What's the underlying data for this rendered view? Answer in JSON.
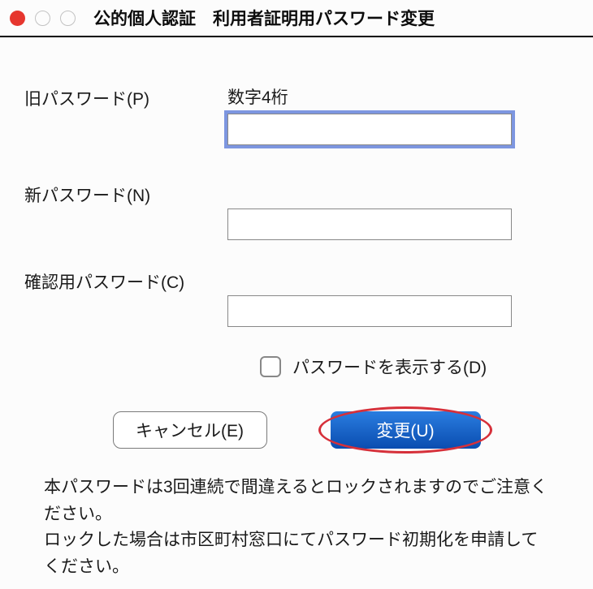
{
  "window": {
    "title": "公的個人認証　利用者証明用パスワード変更"
  },
  "form": {
    "old_password": {
      "label": "旧パスワード(P)",
      "helper": "数字4桁",
      "value": ""
    },
    "new_password": {
      "label": "新パスワード(N)",
      "value": ""
    },
    "confirm_password": {
      "label": "確認用パスワード(C)",
      "value": ""
    },
    "show_password": {
      "label": "パスワードを表示する(D)",
      "checked": false
    }
  },
  "buttons": {
    "cancel": "キャンセル(E)",
    "submit": "変更(U)"
  },
  "notice": {
    "line1": "本パスワードは3回連続で間違えるとロックされますのでご注意ください。",
    "line2": "ロックした場合は市区町村窓口にてパスワード初期化を申請してください。"
  }
}
